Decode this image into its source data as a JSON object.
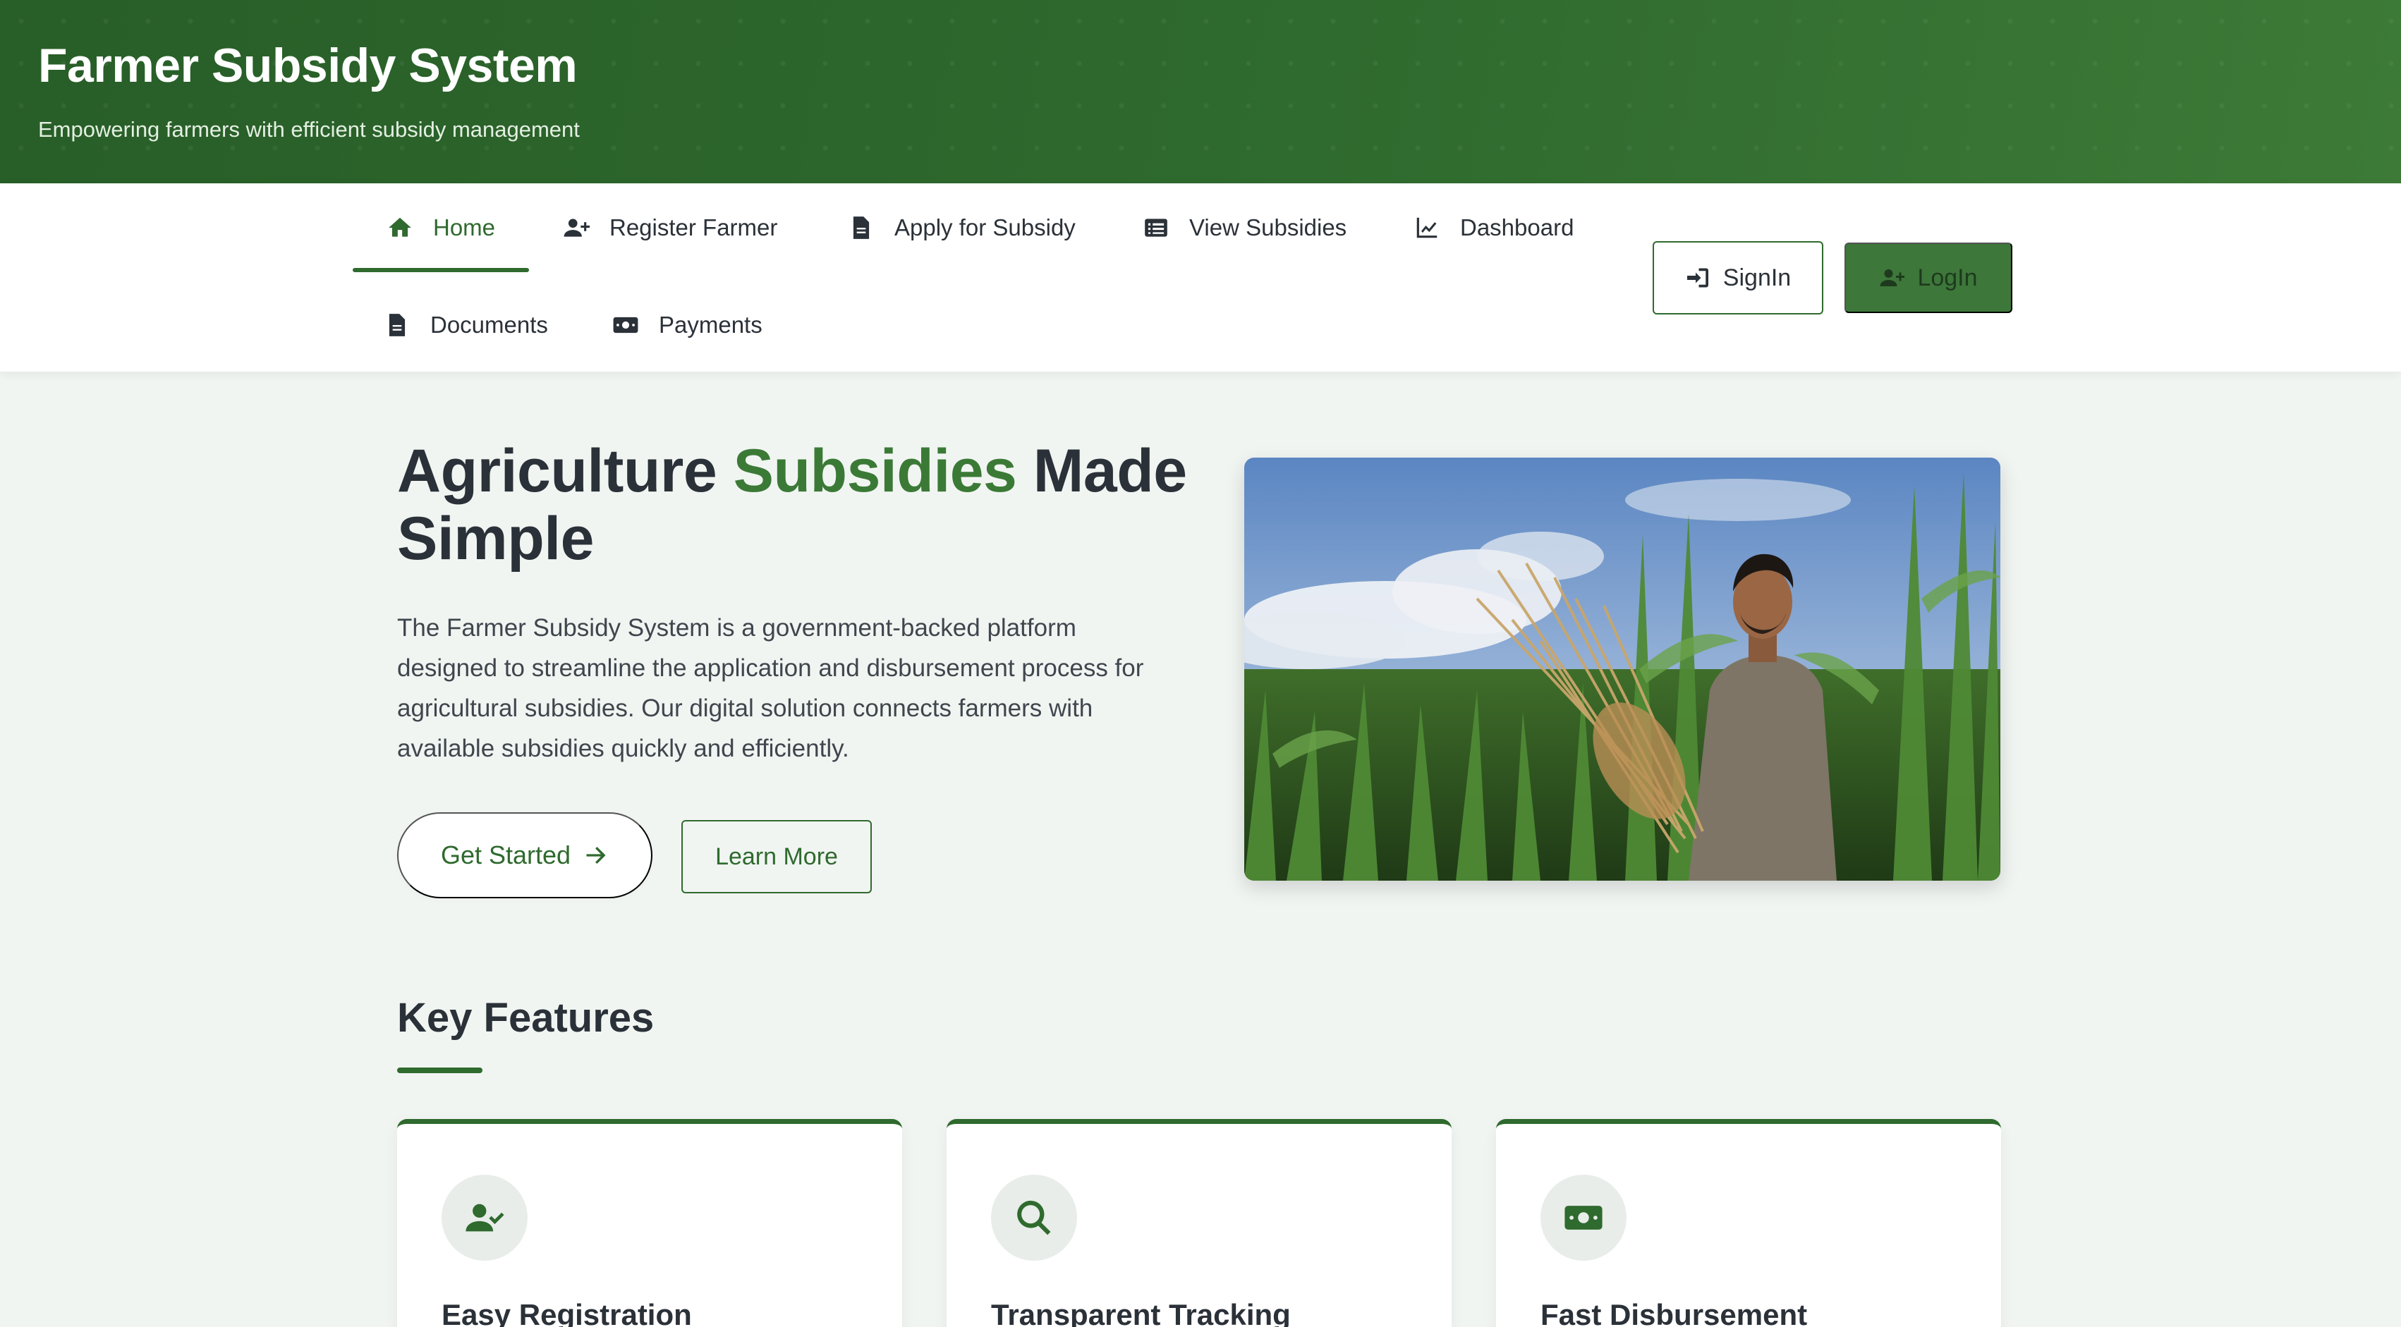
{
  "header": {
    "title": "Farmer Subsidy System",
    "subtitle": "Empowering farmers with efficient subsidy management"
  },
  "nav": {
    "items": [
      {
        "label": "Home",
        "icon": "home-icon",
        "active": true
      },
      {
        "label": "Register Farmer",
        "icon": "user-plus-icon"
      },
      {
        "label": "Apply for Subsidy",
        "icon": "file-icon"
      },
      {
        "label": "View Subsidies",
        "icon": "list-icon"
      },
      {
        "label": "Dashboard",
        "icon": "chart-line-icon"
      },
      {
        "label": "Documents",
        "icon": "file-icon"
      },
      {
        "label": "Payments",
        "icon": "money-icon"
      }
    ],
    "signin_label": "SignIn",
    "login_label": "LogIn"
  },
  "hero": {
    "title_part1": "Agriculture",
    "title_accent": "Subsidies",
    "title_part2": "Made Simple",
    "description": "The Farmer Subsidy System is a government-backed platform designed to streamline the application and disbursement process for agricultural subsidies. Our digital solution connects farmers with available subsidies quickly and efficiently.",
    "primary_cta": "Get Started",
    "secondary_cta": "Learn More"
  },
  "features": {
    "title": "Key Features",
    "cards": [
      {
        "title": "Easy Registration",
        "icon": "user-check-icon"
      },
      {
        "title": "Transparent Tracking",
        "icon": "search-icon"
      },
      {
        "title": "Fast Disbursement",
        "icon": "money-icon"
      }
    ]
  },
  "colors": {
    "brand_green": "#2f6a2e",
    "accent_green": "#3b7a36",
    "background": "#f1f5f2"
  }
}
